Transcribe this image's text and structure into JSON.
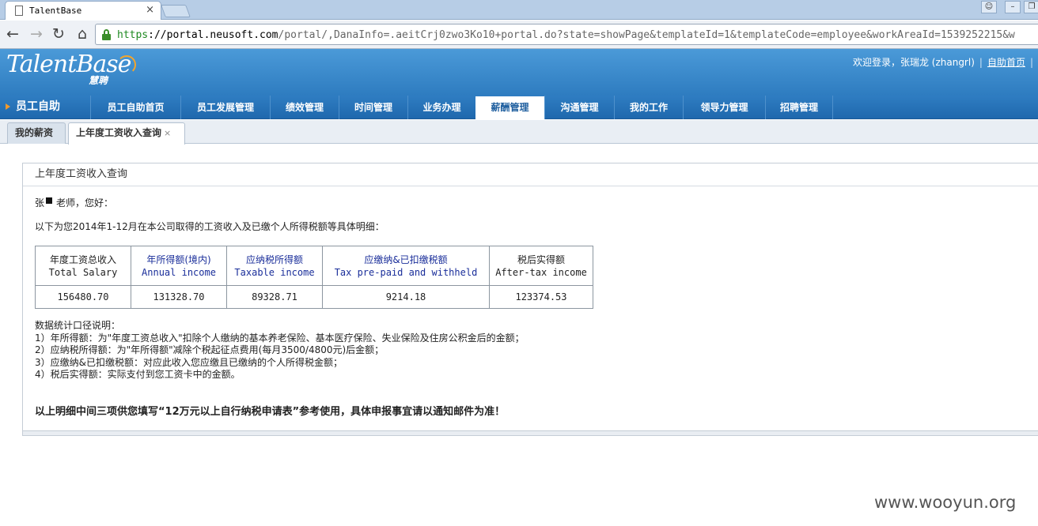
{
  "browser": {
    "tab_title": "TalentBase",
    "url_scheme": "https",
    "url_host": "://portal.neusoft.com",
    "url_rest": "/portal/,DanaInfo=.aeitCrj0zwo3Ko10+portal.do?state=showPage&templateId=1&templateCode=employee&workAreaId=1539252215&w"
  },
  "header": {
    "logo_text": "TalentBase",
    "logo_sub": "慧聘",
    "welcome": "欢迎登录，张瑞龙 (zhangrl)",
    "home_link": "自助首页"
  },
  "nav": {
    "section": "员工自助",
    "items": [
      {
        "label": "员工自助首页"
      },
      {
        "label": "员工发展管理"
      },
      {
        "label": "绩效管理"
      },
      {
        "label": "时间管理"
      },
      {
        "label": "业务办理"
      },
      {
        "label": "薪酬管理"
      },
      {
        "label": "沟通管理"
      },
      {
        "label": "我的工作"
      },
      {
        "label": "领导力管理"
      },
      {
        "label": "招聘管理"
      }
    ],
    "active_index": 5
  },
  "subtabs": [
    {
      "label": "我的薪资"
    },
    {
      "label": "上年度工资收入查询",
      "close": "×"
    }
  ],
  "panel": {
    "title": "上年度工资收入查询",
    "greeting_name": "张",
    "greeting_rest": "老师，您好：",
    "intro": "以下为您2014年1-12月在本公司取得的工资收入及已缴个人所得税额等具体明细：",
    "table": {
      "headers": [
        {
          "cn": "年度工资总收入",
          "en": "Total Salary",
          "blue": false
        },
        {
          "cn": "年所得额(境内)",
          "en": "Annual income",
          "blue": true
        },
        {
          "cn": "应纳税所得额",
          "en": "Taxable income",
          "blue": true
        },
        {
          "cn": "应缴纳&已扣缴税额",
          "en": "Tax pre-paid and withheld",
          "blue": true
        },
        {
          "cn": "税后实得额",
          "en": "After-tax income",
          "blue": false
        }
      ],
      "values": [
        "156480.70",
        "131328.70",
        "89328.71",
        "9214.18",
        "123374.53"
      ]
    },
    "notes_title": "数据统计口径说明：",
    "notes": [
      "1）年所得额：为\"年度工资总收入\"扣除个人缴纳的基本养老保险、基本医疗保险、失业保险及住房公积金后的金额；",
      "2）应纳税所得额：为\"年所得额\"减除个税起征点费用(每月3500/4800元)后金额；",
      "3）应缴纳&已扣缴税额：对应此收入您应缴且已缴纳的个人所得税金额；",
      "4）税后实得额：实际支付到您工资卡中的金额。"
    ],
    "bold_note": "以上明细中间三项供您填写“12万元以上自行纳税申请表”参考使用，具体申报事宜请以通知邮件为准！"
  },
  "watermark": "www.wooyun.org",
  "colors": {
    "header_blue": "#2e7cc0",
    "nav_blue": "#1f68ad",
    "active_text": "#1f5f9f",
    "header_blue_text": "#1a2e9a"
  }
}
